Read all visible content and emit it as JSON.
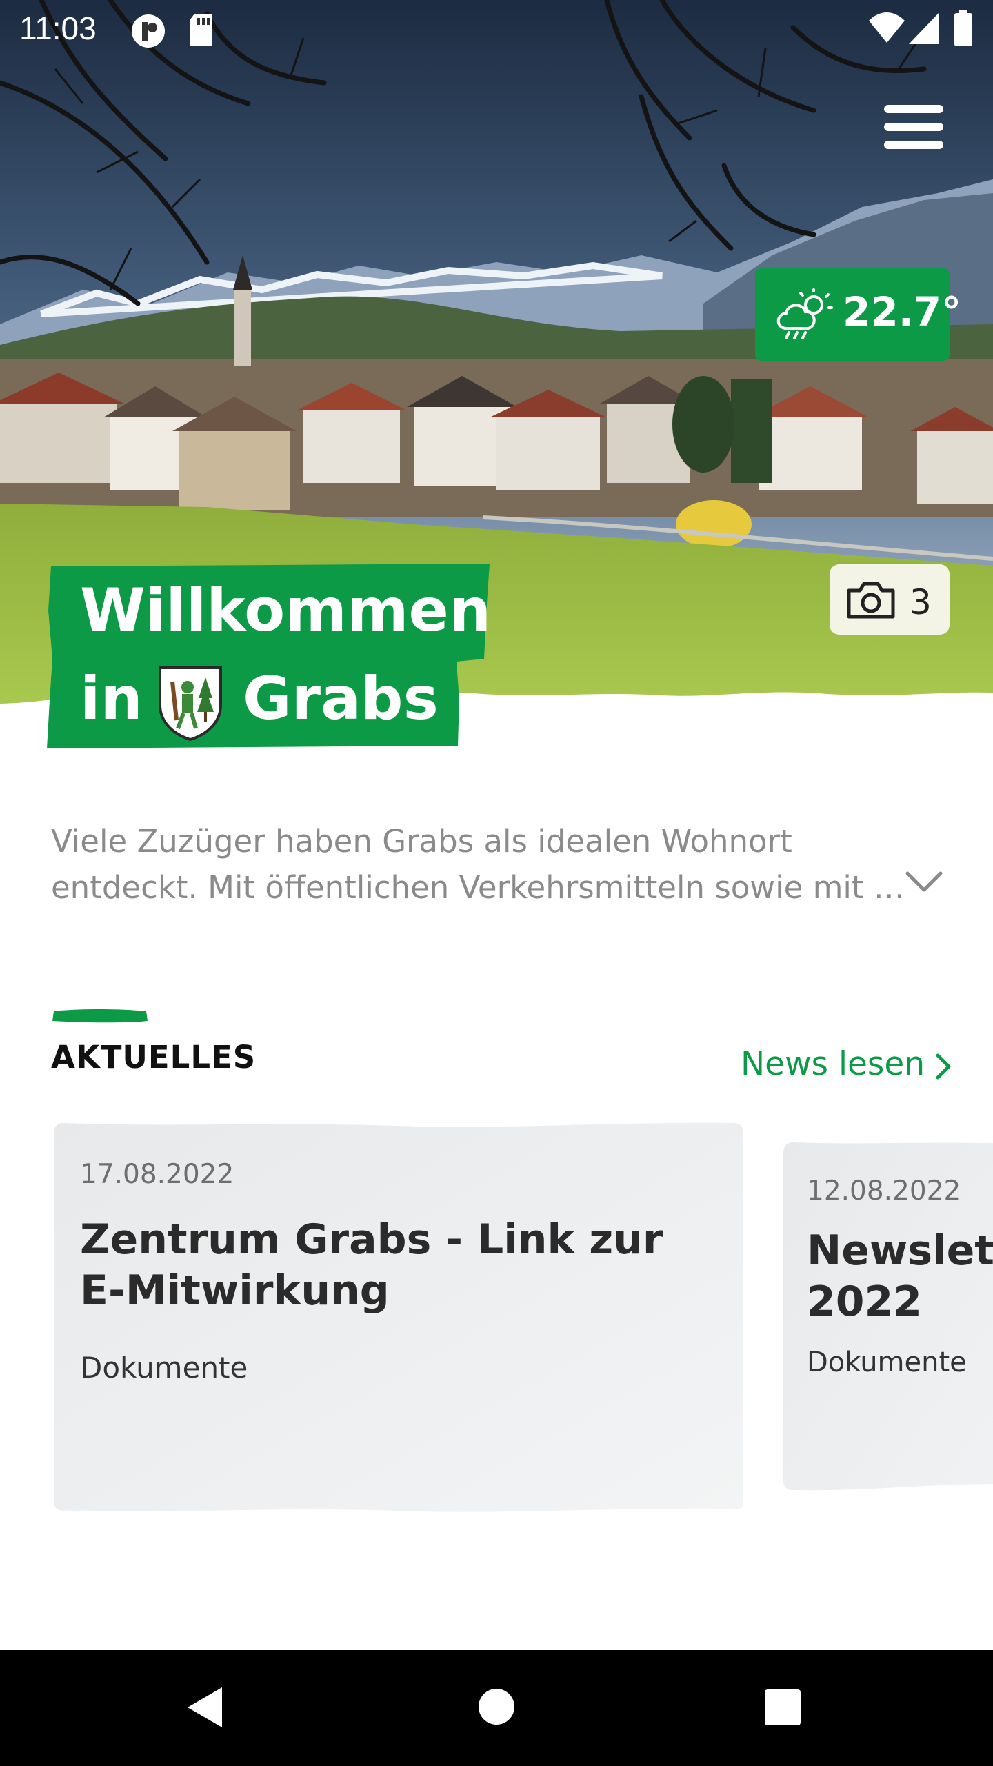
{
  "status_bar": {
    "time": "11:03"
  },
  "hero": {
    "weather": {
      "icon": "cloud-rain-sun-icon",
      "temperature": "22.7°"
    },
    "photo_gallery": {
      "icon": "camera-icon",
      "count": "3"
    },
    "welcome": {
      "line1": "Willkommen",
      "line2_prefix": "in",
      "line2_town": "Grabs"
    }
  },
  "intro": {
    "line1": "Viele Zuzüger haben Grabs als idealen Wohnort",
    "line2": "entdeckt. Mit öffentlichen Verkehrsmitteln sowie mit …"
  },
  "news": {
    "section_title": "AKTUELLES",
    "link_label": "News lesen",
    "items": [
      {
        "date": "17.08.2022",
        "title_line1": "Zentrum Grabs - Link zur",
        "title_line2": "E-Mitwirkung",
        "category": "Dokumente"
      },
      {
        "date": "12.08.2022",
        "title_line1": "Newsletter",
        "title_line2": "2022",
        "category": "Dokumente"
      }
    ]
  },
  "colors": {
    "brand_green": "#0c9a47",
    "card_gray": "#eceeef",
    "navbar": "#000000"
  }
}
